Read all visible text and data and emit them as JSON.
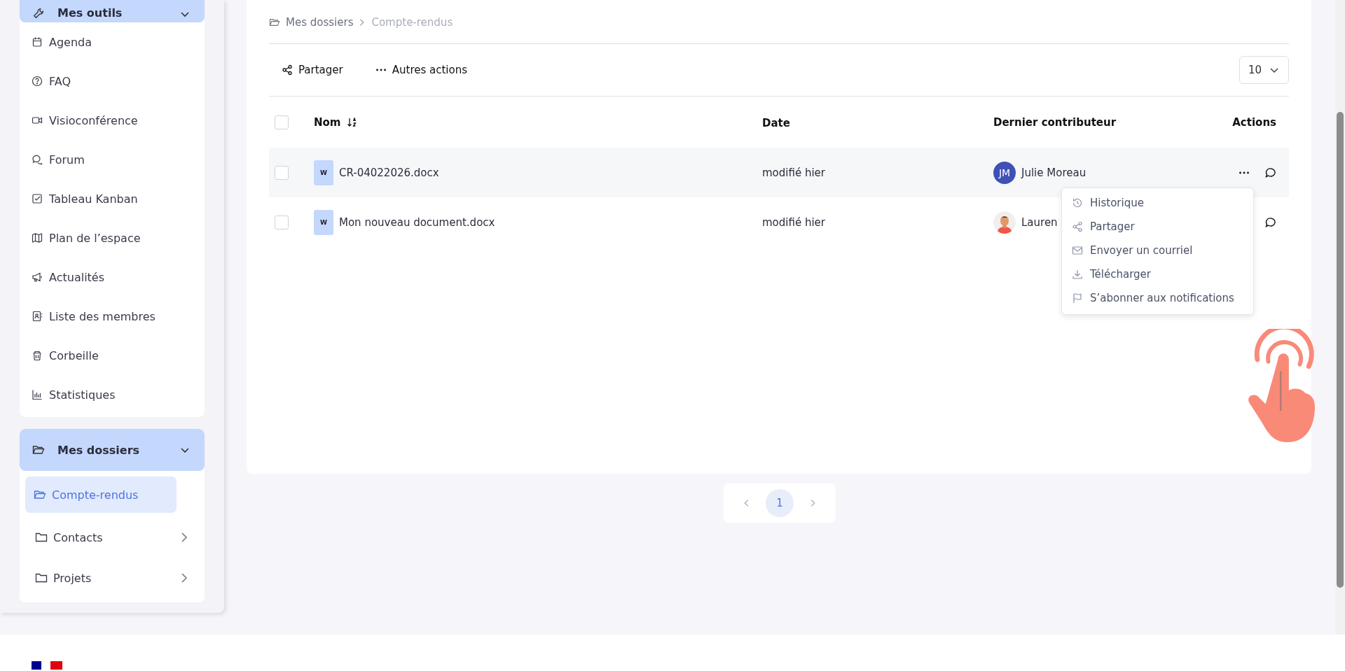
{
  "sidebar": {
    "tools_group": {
      "label": "Mes outils",
      "expanded": true,
      "items": [
        {
          "label": "Agenda"
        },
        {
          "label": "FAQ"
        },
        {
          "label": "Visioconférence"
        },
        {
          "label": "Forum"
        },
        {
          "label": "Tableau Kanban"
        },
        {
          "label": "Plan de l’espace"
        },
        {
          "label": "Actualités"
        },
        {
          "label": "Liste des membres"
        },
        {
          "label": "Corbeille"
        },
        {
          "label": "Statistiques"
        }
      ]
    },
    "folders_group": {
      "label": "Mes dossiers",
      "expanded": true,
      "items": [
        {
          "label": "Compte-rendus",
          "selected": true,
          "has_children": false
        },
        {
          "label": "Contacts",
          "selected": false,
          "has_children": true
        },
        {
          "label": "Projets",
          "selected": false,
          "has_children": true
        }
      ]
    }
  },
  "breadcrumb": [
    {
      "label": "Mes dossiers"
    },
    {
      "label": "Compte-rendus"
    }
  ],
  "toolbar": {
    "actions": [
      {
        "label": "Partager",
        "kind": "share"
      },
      {
        "label": "Autres actions",
        "kind": "more"
      }
    ],
    "page_size": "10"
  },
  "table": {
    "columns": [
      "Nom",
      "Date",
      "Dernier contributeur",
      "Actions"
    ],
    "all_selected": false,
    "rows": [
      {
        "selected": false,
        "file_badge": "W",
        "name": "CR-04022026.docx",
        "date": "modifié hier",
        "contributor": "Julie Moreau",
        "avatar": {
          "kind": "initials",
          "text": "JM"
        },
        "menu_open": true
      },
      {
        "selected": false,
        "file_badge": "W",
        "name": "Mon nouveau document.docx",
        "date": "modifié hier",
        "contributor": "Lauren",
        "menu_open": false
      }
    ]
  },
  "row_menu": {
    "items": [
      {
        "label": "Historique",
        "kind": "history"
      },
      {
        "label": "Partager",
        "kind": "share"
      },
      {
        "label": "Envoyer un courriel",
        "kind": "mail"
      },
      {
        "label": "Télécharger",
        "kind": "download"
      },
      {
        "label": "S’abonner aux notifications",
        "kind": "flag"
      }
    ]
  },
  "pagination": {
    "pages": [
      {
        "label": "1",
        "selected": true
      }
    ]
  }
}
